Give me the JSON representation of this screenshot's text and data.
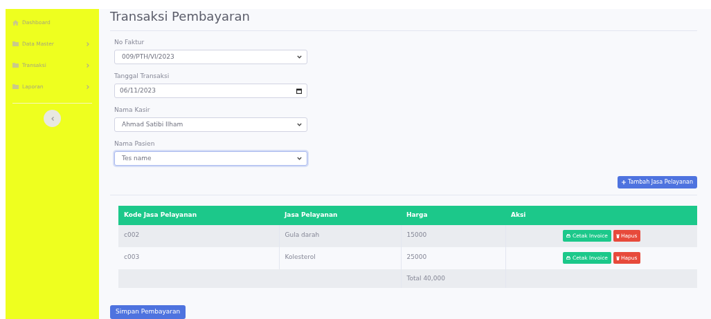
{
  "sidebar": {
    "items": [
      {
        "label": "Dashboard",
        "kind": "home",
        "has_submenu": false
      },
      {
        "label": "Data Master",
        "kind": "folder",
        "has_submenu": true
      },
      {
        "label": "Transaksi",
        "kind": "folder",
        "has_submenu": true
      },
      {
        "label": "Laporan",
        "kind": "folder",
        "has_submenu": true
      }
    ]
  },
  "page_title": "Transaksi Pembayaran",
  "form": {
    "fields": [
      {
        "label": "No Faktur",
        "kind": "select",
        "value": "009/PTH/VI/2023",
        "focused": false
      },
      {
        "label": "Tanggal Transaksi",
        "kind": "date",
        "value": "06/11/2023",
        "focused": false
      },
      {
        "label": "Nama Kasir",
        "kind": "select",
        "value": "Ahmad Satibi Ilham",
        "focused": false
      },
      {
        "label": "Nama Pasien",
        "kind": "select",
        "value": "Tes name",
        "focused": true
      }
    ]
  },
  "add_button": "Tambah Jasa Pelayanan",
  "table": {
    "columns": [
      "Kode Jasa Pelayanan",
      "Jasa Pelayanan",
      "Harga",
      "Aksi"
    ],
    "rows": [
      {
        "cells": [
          "c002",
          "Gula darah",
          "15000"
        ],
        "actions": [
          "Cetak Invoice",
          "Hapus"
        ]
      },
      {
        "cells": [
          "c003",
          "Kolesterol",
          "25000"
        ],
        "actions": [
          "Cetak Invoice",
          "Hapus"
        ]
      }
    ],
    "total": "Total 40,000"
  },
  "save_button": "Simpan Pembayaran"
}
